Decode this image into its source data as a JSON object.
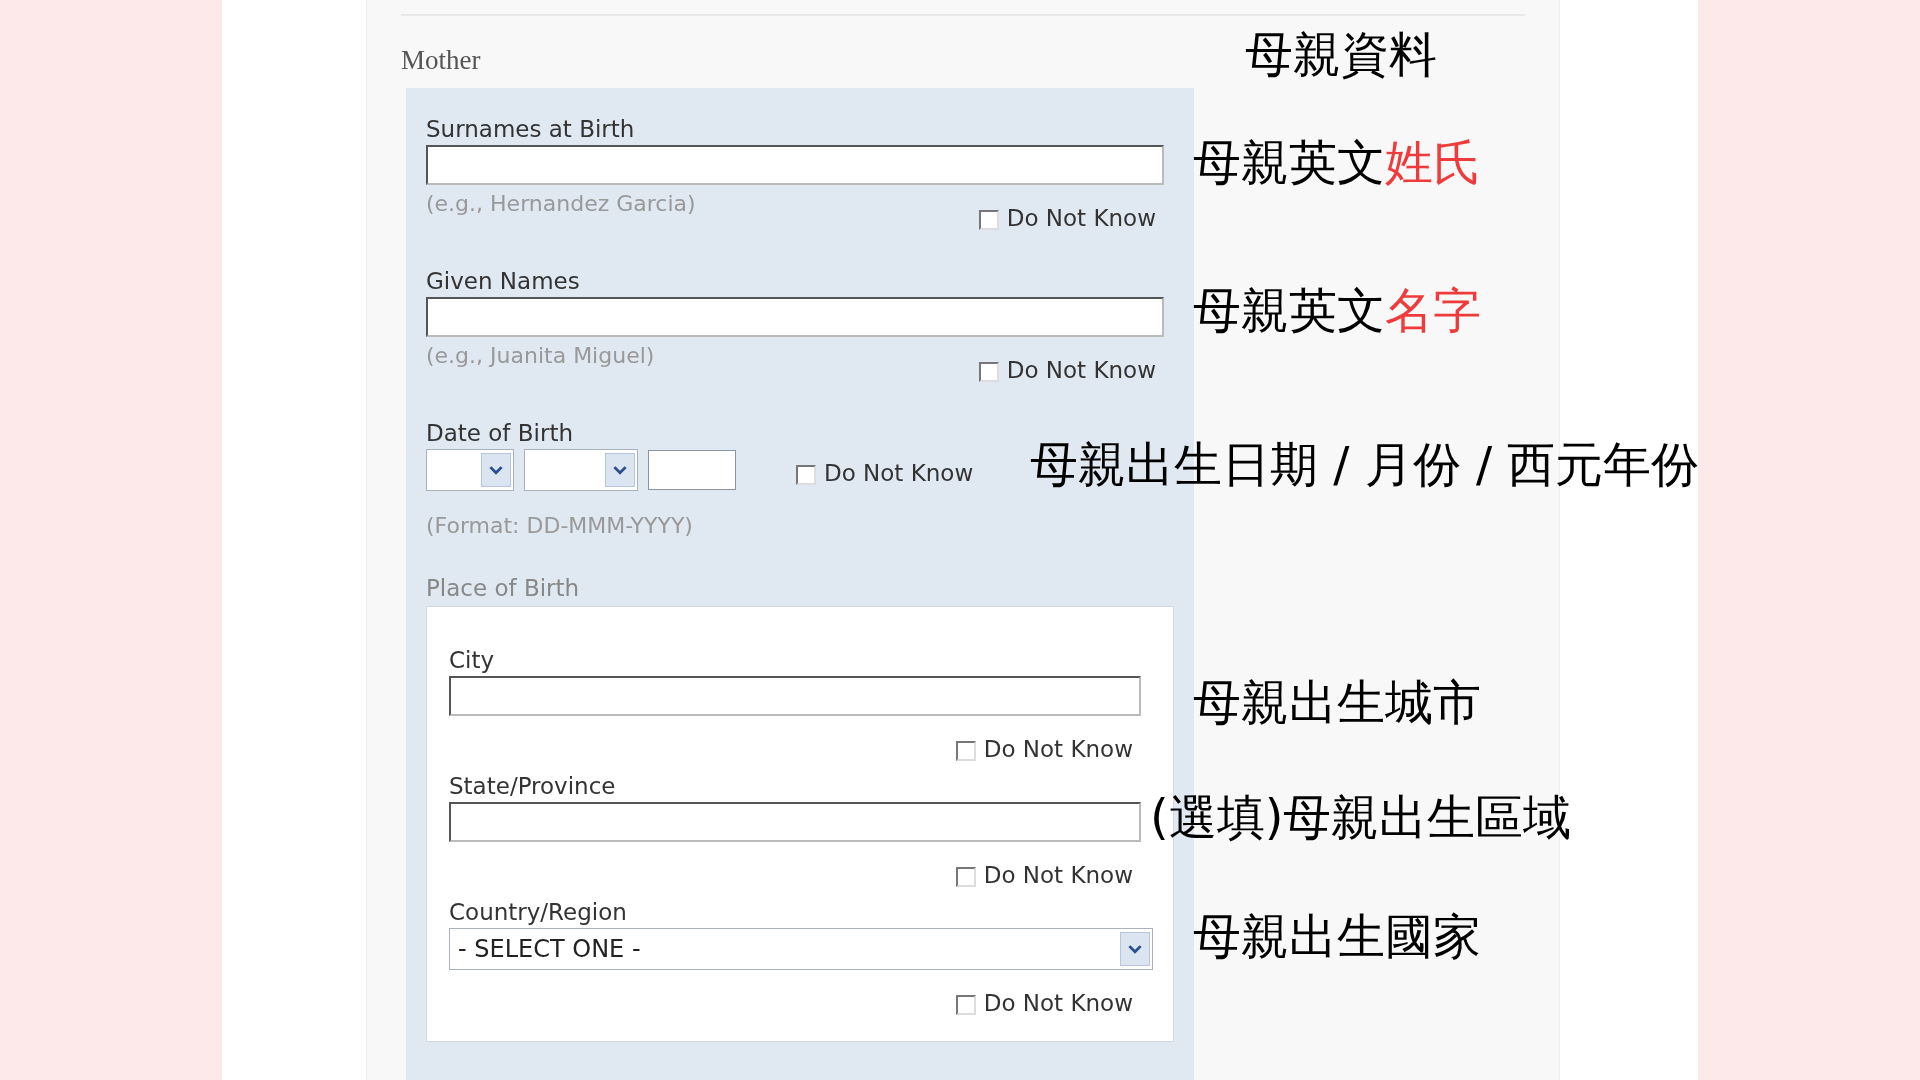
{
  "section": {
    "title": "Mother"
  },
  "fields": [
    {
      "kind": "text",
      "label": "Surnames at Birth",
      "hint": "(e.g., Hernandez Garcia)",
      "do_not_know": {
        "label": "Do Not Know",
        "checked": false
      }
    },
    {
      "kind": "text",
      "label": "Given Names",
      "hint": "(e.g., Juanita Miguel)",
      "do_not_know": {
        "label": "Do Not Know",
        "checked": false
      }
    },
    {
      "kind": "date",
      "label": "Date of Birth",
      "hint": "(Format: DD-MMM-YYYY)",
      "do_not_know": {
        "label": "Do Not Know",
        "checked": false
      }
    }
  ],
  "place_of_birth": {
    "label": "Place of Birth",
    "fields": [
      {
        "kind": "text",
        "label": "City",
        "do_not_know": {
          "label": "Do Not Know",
          "checked": false
        }
      },
      {
        "kind": "text",
        "label": "State/Province",
        "do_not_know": {
          "label": "Do Not Know",
          "checked": false
        }
      },
      {
        "kind": "select",
        "label": "Country/Region",
        "value": "- SELECT ONE -",
        "do_not_know": {
          "label": "Do Not Know",
          "checked": false
        }
      }
    ]
  },
  "annotations": [
    {
      "parts": [
        {
          "text": "母親資料",
          "highlight": false
        }
      ]
    },
    {
      "parts": [
        {
          "text": "母親英文",
          "highlight": false
        },
        {
          "text": "姓氏",
          "highlight": true
        }
      ]
    },
    {
      "parts": [
        {
          "text": "母親英文",
          "highlight": false
        },
        {
          "text": "名字",
          "highlight": true
        }
      ]
    },
    {
      "parts": [
        {
          "text": "母親出生日期 / 月份 / 西元年份",
          "highlight": false
        }
      ]
    },
    {
      "parts": [
        {
          "text": "母親出生城市",
          "highlight": false
        }
      ]
    },
    {
      "parts": [
        {
          "text": "(選填)母親出生區域",
          "highlight": false
        }
      ]
    },
    {
      "parts": [
        {
          "text": "母親出生國家",
          "highlight": false
        }
      ]
    }
  ]
}
